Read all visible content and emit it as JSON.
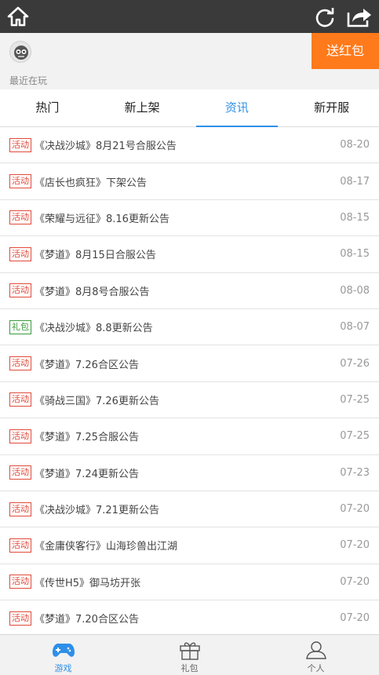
{
  "header": {
    "home_icon": "home-icon",
    "refresh_icon": "refresh-icon",
    "share_icon": "share-icon"
  },
  "user": {
    "avatar_icon": "robot-avatar-icon",
    "red_packet_label": "送红包"
  },
  "recent_label": "最近在玩",
  "tabs": [
    {
      "label": "热门"
    },
    {
      "label": "新上架"
    },
    {
      "label": "资讯",
      "active": true
    },
    {
      "label": "新开服"
    }
  ],
  "news": [
    {
      "tag": "活动",
      "title": "《决战沙城》8月21号合服公告",
      "date": "08-20"
    },
    {
      "tag": "活动",
      "title": "《店长也疯狂》下架公告",
      "date": "08-17"
    },
    {
      "tag": "活动",
      "title": "《荣耀与远征》8.16更新公告",
      "date": "08-15"
    },
    {
      "tag": "活动",
      "title": "《梦道》8月15日合服公告",
      "date": "08-15"
    },
    {
      "tag": "活动",
      "title": "《梦道》8月8号合服公告",
      "date": "08-08"
    },
    {
      "tag": "礼包",
      "title": "《决战沙城》8.8更新公告",
      "date": "08-07"
    },
    {
      "tag": "活动",
      "title": "《梦道》7.26合区公告",
      "date": "07-26"
    },
    {
      "tag": "活动",
      "title": "《骑战三国》7.26更新公告",
      "date": "07-25"
    },
    {
      "tag": "活动",
      "title": "《梦道》7.25合服公告",
      "date": "07-25"
    },
    {
      "tag": "活动",
      "title": "《梦道》7.24更新公告",
      "date": "07-23"
    },
    {
      "tag": "活动",
      "title": "《决战沙城》7.21更新公告",
      "date": "07-20"
    },
    {
      "tag": "活动",
      "title": "《金庸侠客行》山海珍兽出江湖",
      "date": "07-20"
    },
    {
      "tag": "活动",
      "title": "《传世H5》御马坊开张",
      "date": "07-20"
    },
    {
      "tag": "活动",
      "title": "《梦道》7.20合区公告",
      "date": "07-20"
    }
  ],
  "bottom_nav": [
    {
      "label": "游戏",
      "icon": "gamepad-icon",
      "active": true
    },
    {
      "label": "礼包",
      "icon": "gift-icon"
    },
    {
      "label": "个人",
      "icon": "user-icon"
    }
  ],
  "colors": {
    "topbar": "#3a3a3a",
    "accent_blue": "#2f8fe8",
    "red_packet_orange": "#ff7a1a",
    "tag_event_red": "#e04a3a",
    "tag_gift_green": "#3a9a3a"
  }
}
